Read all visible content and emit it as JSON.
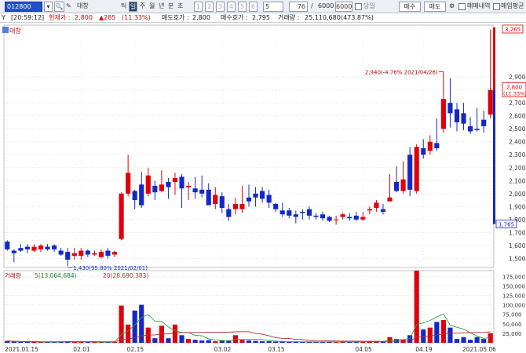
{
  "toolbar": {
    "code": "012800",
    "name": "대창",
    "items": [
      {
        "key": "tick",
        "label": "틱"
      },
      {
        "key": "day",
        "label": "일"
      },
      {
        "key": "week",
        "label": "주"
      },
      {
        "key": "month",
        "label": "월"
      },
      {
        "key": "year",
        "label": "년"
      },
      {
        "key": "minute",
        "label": "분"
      },
      {
        "key": "sec",
        "label": "초"
      }
    ],
    "numbers": [
      "1",
      "2",
      "3",
      "4",
      "5",
      "6",
      "5"
    ],
    "count": "76",
    "total": "6000",
    "total2": "6000",
    "checkbox_label": "당일",
    "buy_label": "매수",
    "sell_label": "매도",
    "trade_label": "매매내역",
    "avg_label": "매입평균"
  },
  "status": {
    "time": "[20:59:12]",
    "current_label": "현재가 :",
    "current_value": "2,800",
    "change": "▲285",
    "change_pct": "(11.33%)",
    "ask_label": "매도호가 :",
    "ask_value": "2,800",
    "bid_label": "매수호가 :",
    "bid_value": "2,795",
    "volume_label": "거래량 :",
    "volume_value": "25,110,680",
    "volume_pct": "(473.87%)"
  },
  "chart_data": [
    {
      "type": "candlestick",
      "title": "대창",
      "x_ticks": [
        "2021.01.15",
        "02.01",
        "02.15",
        "03.02",
        "03.15",
        "04.05",
        "04.19",
        "2021.05.06"
      ],
      "y_ticks": [
        1500,
        1600,
        1700,
        1800,
        1900,
        2000,
        2100,
        2200,
        2300,
        2400,
        2500,
        2600,
        2700,
        2800,
        2900
      ],
      "y_range": [
        1430,
        3300
      ],
      "annotations": [
        {
          "text": "1,430(95.80% 2021/02/01)",
          "value": 1430
        },
        {
          "text": "2,940(-4.76% 2021/04/26)",
          "value": 2940
        }
      ],
      "labels": {
        "current": "2,800",
        "current_pct": "(11.33%)",
        "high": "3,265",
        "low": "1,765"
      },
      "candles": [
        [
          1630,
          1570,
          1640,
          1560
        ],
        [
          1560,
          1540,
          1570,
          1470
        ],
        [
          1580,
          1560,
          1610,
          1550
        ],
        [
          1590,
          1570,
          1610,
          1540
        ],
        [
          1560,
          1590,
          1610,
          1550
        ],
        [
          1570,
          1600,
          1610,
          1550
        ],
        [
          1590,
          1570,
          1610,
          1560
        ],
        [
          1600,
          1570,
          1610,
          1550
        ],
        [
          1560,
          1530,
          1580,
          1520
        ],
        [
          1550,
          1490,
          1580,
          1440
        ],
        [
          1520,
          1540,
          1580,
          1490
        ],
        [
          1520,
          1560,
          1580,
          1490
        ],
        [
          1560,
          1530,
          1570,
          1510
        ],
        [
          1530,
          1540,
          1560,
          1520
        ],
        [
          1510,
          1550,
          1570,
          1500
        ],
        [
          1560,
          1520,
          1580,
          1500
        ],
        [
          1530,
          1550,
          1560,
          1510
        ],
        [
          1650,
          2000,
          2010,
          1640
        ],
        [
          2000,
          2160,
          2300,
          1980
        ],
        [
          2020,
          1950,
          2030,
          1880
        ],
        [
          2070,
          1910,
          2170,
          1890
        ],
        [
          2000,
          2140,
          2200,
          1980
        ],
        [
          2060,
          2010,
          2100,
          1950
        ],
        [
          2020,
          2070,
          2180,
          2010
        ],
        [
          2090,
          2050,
          2120,
          1960
        ],
        [
          2090,
          2120,
          2160,
          1990
        ],
        [
          2130,
          2040,
          2150,
          1890
        ],
        [
          2050,
          2060,
          2090,
          1950
        ],
        [
          2040,
          2010,
          2130,
          1960
        ],
        [
          2030,
          2000,
          2140,
          1970
        ],
        [
          2030,
          1910,
          2080,
          1920
        ],
        [
          1920,
          1990,
          2050,
          1880
        ],
        [
          1980,
          1890,
          2010,
          1850
        ],
        [
          1880,
          1820,
          1920,
          1790
        ],
        [
          1880,
          1920,
          1970,
          1840
        ],
        [
          1880,
          1920,
          2060,
          1850
        ],
        [
          1970,
          1940,
          2070,
          1900
        ],
        [
          2000,
          1970,
          2050,
          1900
        ],
        [
          2020,
          1960,
          2050,
          1930
        ],
        [
          1990,
          1930,
          2030,
          1890
        ],
        [
          1920,
          1880,
          1930,
          1860
        ],
        [
          1870,
          1840,
          1930,
          1820
        ],
        [
          1870,
          1830,
          1890,
          1810
        ],
        [
          1840,
          1820,
          1870,
          1770
        ],
        [
          1860,
          1850,
          1880,
          1800
        ],
        [
          1880,
          1830,
          1900,
          1800
        ],
        [
          1830,
          1820,
          1850,
          1800
        ],
        [
          1840,
          1810,
          1860,
          1790
        ],
        [
          1820,
          1790,
          1830,
          1780
        ],
        [
          1800,
          1800,
          1830,
          1760
        ],
        [
          1820,
          1840,
          1850,
          1800
        ],
        [
          1820,
          1810,
          1850,
          1790
        ],
        [
          1830,
          1800,
          1860,
          1790
        ],
        [
          1800,
          1820,
          1860,
          1790
        ],
        [
          1870,
          1880,
          1900,
          1840
        ],
        [
          1890,
          1930,
          1950,
          1860
        ],
        [
          1880,
          1860,
          1920,
          1840
        ],
        [
          1940,
          1970,
          2150,
          1950
        ],
        [
          2090,
          2020,
          2210,
          2010
        ],
        [
          2020,
          2110,
          2250,
          2000
        ],
        [
          2300,
          2030,
          2360,
          1980
        ],
        [
          2020,
          2360,
          2380,
          2000
        ],
        [
          2350,
          2300,
          2420,
          2270
        ],
        [
          2330,
          2400,
          2450,
          2300
        ],
        [
          2390,
          2350,
          2580,
          2330
        ],
        [
          2500,
          2730,
          2940,
          2470
        ],
        [
          2700,
          2620,
          2890,
          2510
        ],
        [
          2650,
          2550,
          2700,
          2480
        ],
        [
          2620,
          2540,
          2700,
          2490
        ],
        [
          2520,
          2480,
          2590,
          2460
        ],
        [
          2500,
          2490,
          2660,
          2480
        ],
        [
          2570,
          2520,
          2640,
          2470
        ],
        [
          2610,
          2800,
          3265,
          2580
        ]
      ]
    },
    {
      "type": "bar",
      "title": "거래량",
      "series_labels": [
        "5(13,064,684)",
        "20(28,690,383)"
      ],
      "y_ticks": [
        25000,
        50000,
        75000,
        100000,
        125000,
        150000,
        175000
      ],
      "y_tick_labels": [
        "25,000",
        "50,000",
        "75,000",
        "100,000",
        "125,000",
        "150,000",
        "175,000"
      ],
      "y_range": [
        0,
        190000
      ],
      "volumes": [
        5000,
        3000,
        2000,
        2000,
        2500,
        2000,
        2000,
        2500,
        3000,
        4000,
        3000,
        2000,
        2000,
        2000,
        2500,
        2500,
        2000,
        98000,
        48000,
        85000,
        100000,
        40000,
        12000,
        45000,
        12000,
        48000,
        20000,
        10000,
        8000,
        6000,
        7000,
        4000,
        6000,
        5000,
        20000,
        8000,
        6000,
        5000,
        4000,
        4000,
        3000,
        3000,
        2500,
        2500,
        2000,
        3000,
        2500,
        2500,
        2000,
        2000,
        4000,
        3000,
        2000,
        3000,
        5000,
        5000,
        4000,
        15000,
        10000,
        8000,
        20000,
        190000,
        35000,
        40000,
        55000,
        60000,
        40000,
        10000,
        15000,
        8000,
        15000,
        10000,
        25000
      ]
    }
  ]
}
